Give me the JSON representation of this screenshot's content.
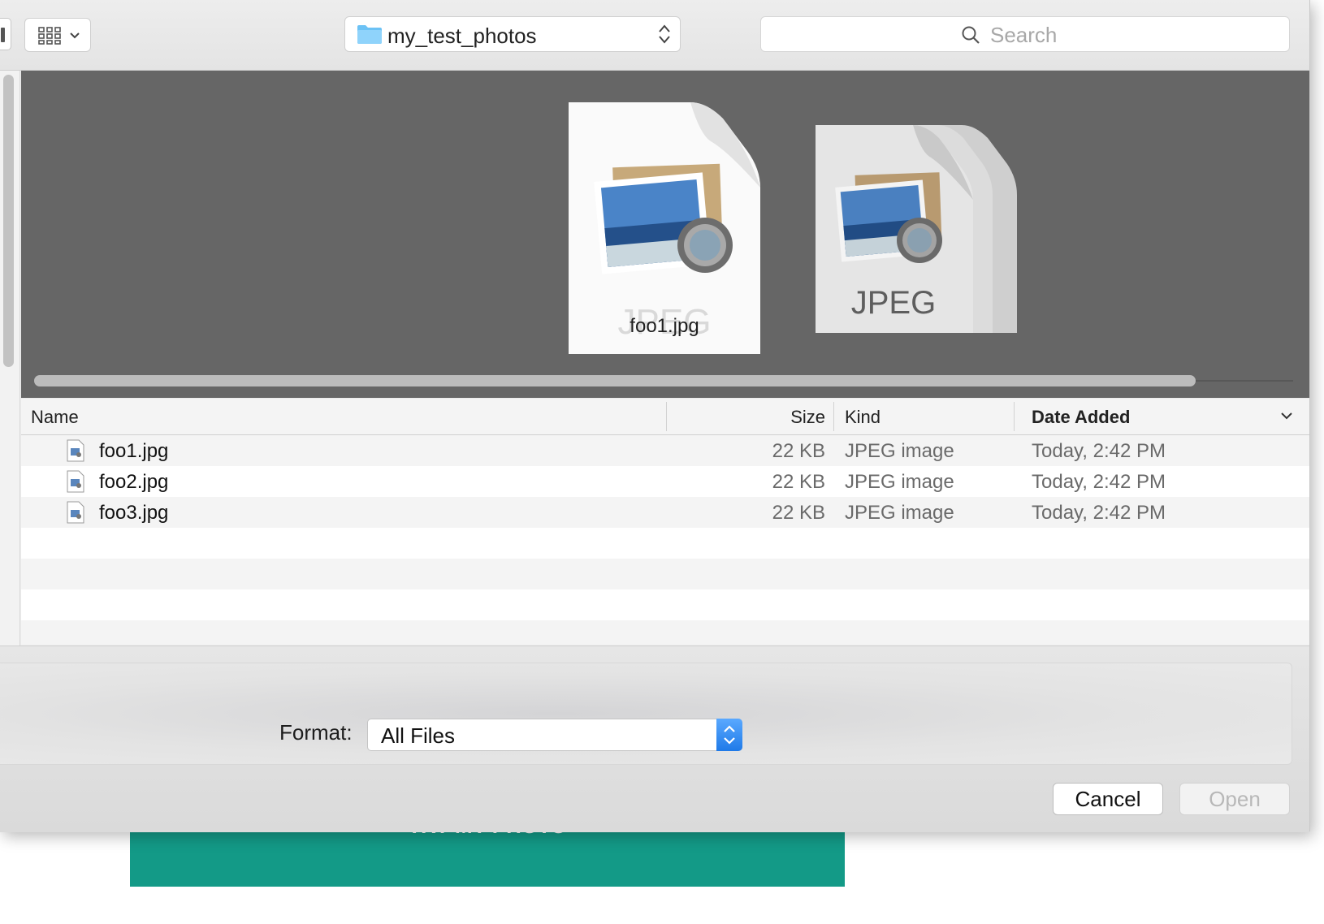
{
  "background_page": {
    "cta_label": "TRY MY PHOTO"
  },
  "toolbar": {
    "path": "my_test_photos",
    "search_placeholder": "Search",
    "icons": [
      "sidebar-icon",
      "icon-view-grid-icon",
      "chevron-down-icon",
      "folder-icon",
      "up-down-arrows-icon",
      "search-icon"
    ]
  },
  "preview": {
    "selected_filename": "foo1.jpg",
    "stack_label": "JPEG",
    "selected_label_ghost": "JPEG",
    "horizontal_scroll_fraction": 0.92
  },
  "list": {
    "columns": {
      "name": "Name",
      "size": "Size",
      "kind": "Kind",
      "date": "Date Added"
    },
    "sorted_by": "Date Added",
    "rows": [
      {
        "name": "foo1.jpg",
        "size": "22 KB",
        "kind": "JPEG image",
        "date": "Today, 2:42 PM"
      },
      {
        "name": "foo2.jpg",
        "size": "22 KB",
        "kind": "JPEG image",
        "date": "Today, 2:42 PM"
      },
      {
        "name": "foo3.jpg",
        "size": "22 KB",
        "kind": "JPEG image",
        "date": "Today, 2:42 PM"
      }
    ]
  },
  "accessory": {
    "format_label": "Format:",
    "format_value": "All Files"
  },
  "buttons": {
    "cancel": "Cancel",
    "open": "Open",
    "open_enabled": false
  },
  "colors": {
    "accent": "#1f7ae8",
    "cta": "#139a87",
    "preview_bg": "#666666"
  }
}
